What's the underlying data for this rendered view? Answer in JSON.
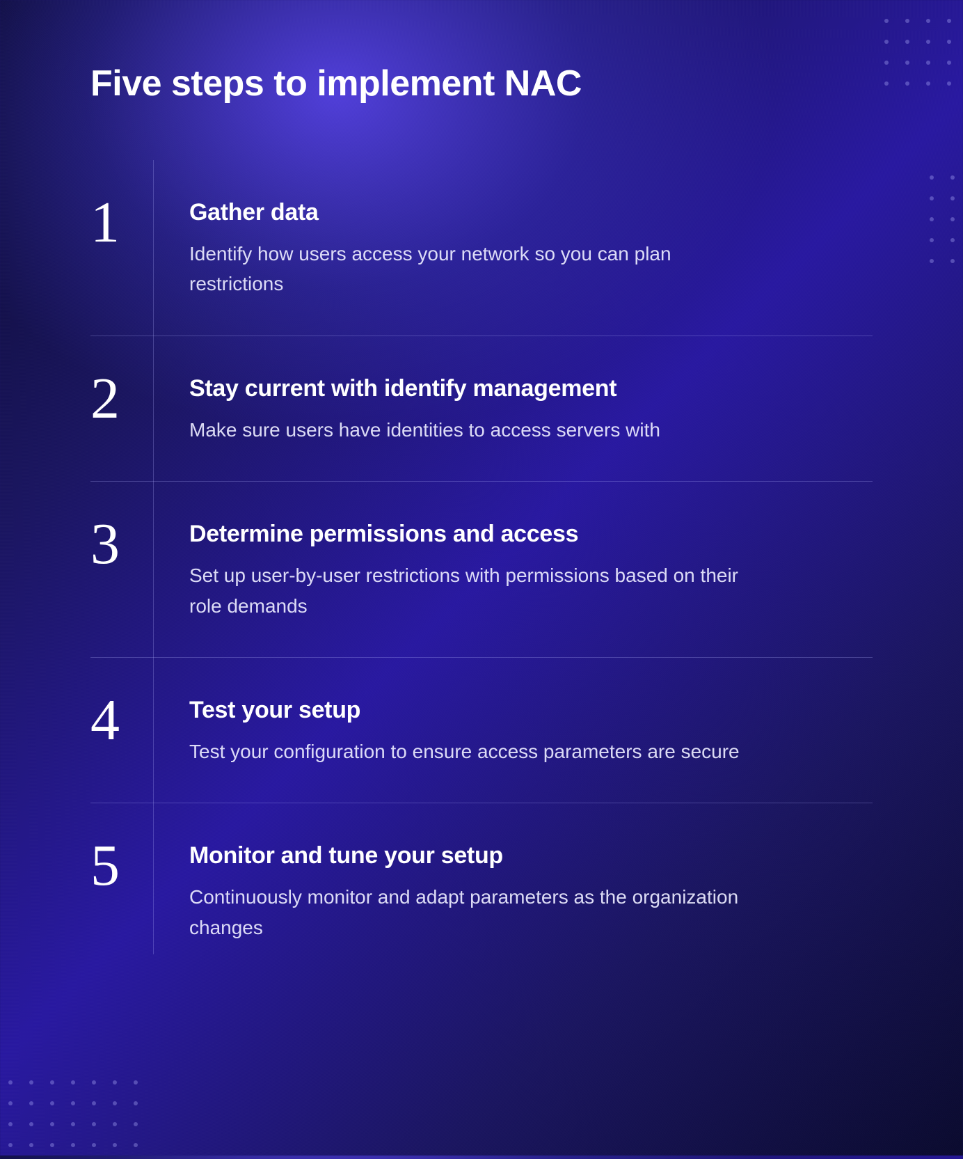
{
  "title": "Five steps to implement NAC",
  "steps": [
    {
      "num": "1",
      "title": "Gather data",
      "desc": "Identify how users access your network so you can plan restrictions"
    },
    {
      "num": "2",
      "title": "Stay current with identify management",
      "desc": "Make sure users have identities to access servers with"
    },
    {
      "num": "3",
      "title": "Determine permissions and access",
      "desc": "Set up user-by-user restrictions with permissions based on their role demands"
    },
    {
      "num": "4",
      "title": "Test your setup",
      "desc": "Test your configuration to ensure access parameters are secure"
    },
    {
      "num": "5",
      "title": "Monitor and tune your setup",
      "desc": "Continuously monitor and adapt parameters as the organization changes"
    }
  ]
}
